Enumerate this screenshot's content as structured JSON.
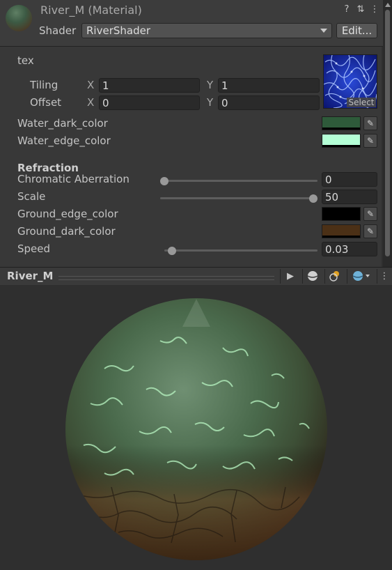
{
  "header": {
    "title": "River_M (Material)",
    "shader_label": "Shader",
    "shader_value": "RiverShader",
    "edit_label": "Edit...",
    "icons": [
      "help-icon",
      "preset-icon",
      "more-icon"
    ]
  },
  "props": {
    "tex": {
      "label": "tex",
      "tiling_label": "Tiling",
      "offset_label": "Offset",
      "x_label": "X",
      "y_label": "Y",
      "tiling_x": "1",
      "tiling_y": "1",
      "offset_x": "0",
      "offset_y": "0",
      "select_label": "Select"
    },
    "water_dark": {
      "label": "Water_dark_color",
      "color": "#2e5a3a"
    },
    "water_edge": {
      "label": "Water_edge_color",
      "color": "#b4ffd6"
    },
    "section": "Refraction",
    "chromatic": {
      "label": "Chromatic Aberration",
      "value": "0",
      "fraction": 0.0
    },
    "scale": {
      "label": "Scale",
      "value": "50",
      "fraction": 1.0
    },
    "ground_edge": {
      "label": "Ground_edge_color",
      "color": "#000000"
    },
    "ground_dark": {
      "label": "Ground_dark_color",
      "color": "#4b3016"
    },
    "speed": {
      "label": "Speed",
      "value": "0.03",
      "fraction": 0.05
    }
  },
  "preview": {
    "title": "River_M",
    "icons": [
      "play-icon",
      "sphere-icon",
      "light-icon",
      "mesh-icon",
      "more-icon"
    ]
  }
}
